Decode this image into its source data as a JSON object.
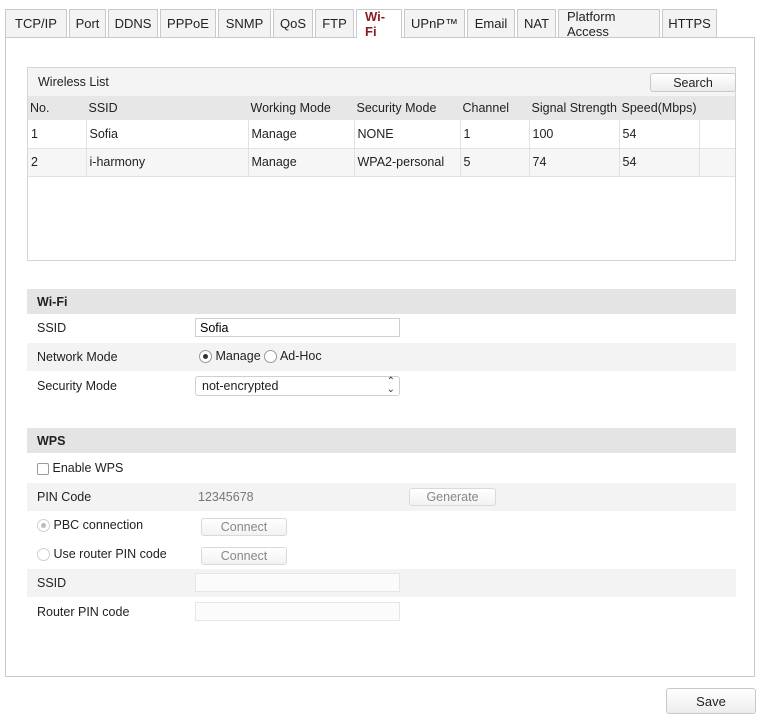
{
  "tabs": [
    {
      "label": "TCP/IP",
      "active": false
    },
    {
      "label": "Port",
      "active": false
    },
    {
      "label": "DDNS",
      "active": false
    },
    {
      "label": "PPPoE",
      "active": false
    },
    {
      "label": "SNMP",
      "active": false
    },
    {
      "label": "QoS",
      "active": false
    },
    {
      "label": "FTP",
      "active": false
    },
    {
      "label": "Wi-Fi",
      "active": true
    },
    {
      "label": "UPnP™",
      "active": false
    },
    {
      "label": "Email",
      "active": false
    },
    {
      "label": "NAT",
      "active": false
    },
    {
      "label": "Platform Access",
      "active": false
    },
    {
      "label": "HTTPS",
      "active": false
    }
  ],
  "wireless_list": {
    "title": "Wireless List",
    "search_label": "Search",
    "columns": [
      "No.",
      "SSID",
      "Working Mode",
      "Security Mode",
      "Channel",
      "Signal Strength",
      "Speed(Mbps)"
    ],
    "rows": [
      {
        "no": "1",
        "ssid": "Sofia",
        "mode": "Manage",
        "security": "NONE",
        "channel": "1",
        "signal": "100",
        "speed": "54"
      },
      {
        "no": "2",
        "ssid": "i-harmony",
        "mode": "Manage",
        "security": "WPA2-personal",
        "channel": "5",
        "signal": "74",
        "speed": "54"
      }
    ]
  },
  "wifi": {
    "section_title": "Wi-Fi",
    "ssid_label": "SSID",
    "ssid_value": "Sofia",
    "network_mode_label": "Network Mode",
    "mode_manage": "Manage",
    "mode_adhoc": "Ad-Hoc",
    "selected_mode": "Manage",
    "security_mode_label": "Security Mode",
    "security_mode_value": "not-encrypted"
  },
  "wps": {
    "section_title": "WPS",
    "enable_label": "Enable WPS",
    "enabled": false,
    "pin_code_label": "PIN Code",
    "pin_code_value": "12345678",
    "generate_label": "Generate",
    "pbc_label": "PBC connection",
    "use_router_pin_label": "Use router PIN code",
    "connect_label": "Connect",
    "ssid_label": "SSID",
    "ssid_value": "",
    "router_pin_label": "Router PIN code",
    "router_pin_value": ""
  },
  "footer": {
    "save_label": "Save"
  },
  "icons": {
    "select_arrows": "updown-chevron-icon"
  },
  "colors": {
    "active_tab_text": "#8b1e1e",
    "section_header_bg": "#e4e4e4"
  }
}
